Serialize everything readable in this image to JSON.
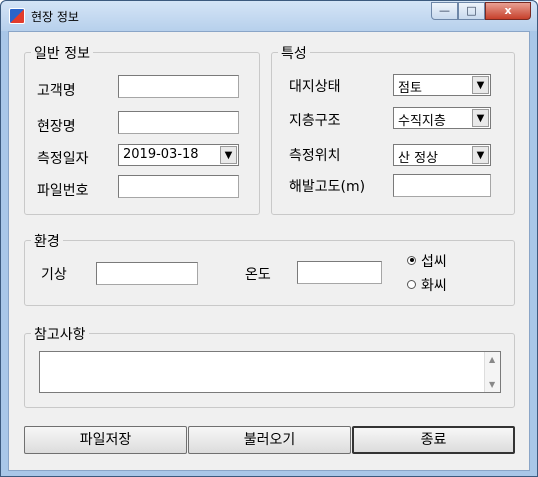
{
  "window": {
    "title": "현장 정보",
    "min_glyph": "—",
    "max_glyph": "□",
    "close_glyph": "x"
  },
  "general": {
    "legend": "일반 정보",
    "customer_label": "고객명",
    "customer_value": "",
    "site_label": "현장명",
    "site_value": "",
    "date_label": "측정일자",
    "date_value": "2019-03-18",
    "file_label": "파일번호",
    "file_value": ""
  },
  "properties": {
    "legend": "특성",
    "ground_label": "대지상태",
    "ground_value": "점토",
    "strata_label": "지층구조",
    "strata_value": "수직지층",
    "position_label": "측정위치",
    "position_value": "산 정상",
    "altitude_label": "해발고도(m)",
    "altitude_value": ""
  },
  "environment": {
    "legend": "환경",
    "weather_label": "기상",
    "weather_value": "",
    "temp_label": "온도",
    "temp_value": "",
    "unit_celsius": "섭씨",
    "unit_fahrenheit": "화씨",
    "selected_unit": "celsius"
  },
  "notes": {
    "legend": "참고사항",
    "value": ""
  },
  "buttons": {
    "save": "파일저장",
    "load": "불러오기",
    "exit": "종료"
  },
  "glyphs": {
    "dropdown": "▼",
    "scroll_up": "▲",
    "scroll_down": "▼"
  }
}
